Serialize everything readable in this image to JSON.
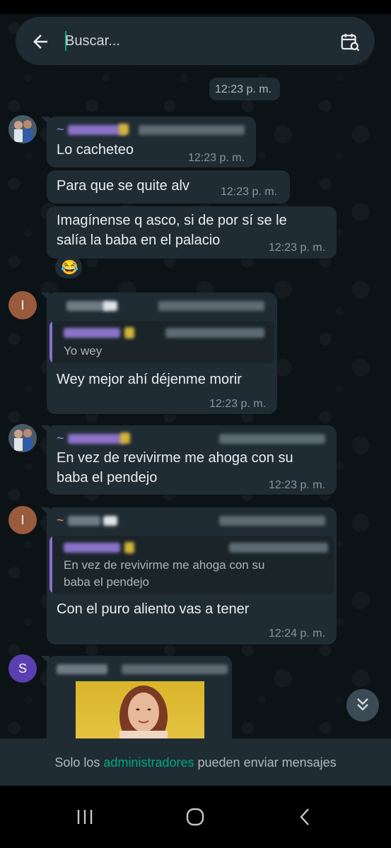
{
  "search": {
    "placeholder": "Buscar..."
  },
  "date_pill": "12:23 p. m.",
  "messages": [
    {
      "text": "Lo cacheteo",
      "time": "12:23 p. m."
    },
    {
      "text": "Para que se quite alv",
      "time": "12:23 p. m."
    },
    {
      "line1": "Imagínense q asco, si de por sí se le",
      "line2": "salía la baba en el palacio",
      "time": "12:23 p. m."
    },
    {
      "quote": "Yo wey",
      "text": "Wey mejor ahí déjenme morir",
      "time": "12:23 p. m."
    },
    {
      "line1": "En vez de revivirme me ahoga con su",
      "line2": "baba el pendejo",
      "time": "12:23 p. m."
    },
    {
      "quote_line1": "En vez de revivirme me ahoga con su",
      "quote_line2": "baba el pendejo",
      "text": "Con el puro aliento vas a tener",
      "time": "12:24 p. m."
    }
  ],
  "avatars": {
    "i_letter": "I",
    "s_letter": "S"
  },
  "sender_prefix": "~",
  "reaction_emoji": "😂",
  "footer": {
    "prefix": "Solo los",
    "highlight": "administradores",
    "suffix": "pueden enviar mensajes"
  },
  "colors": {
    "accent": "#00a884",
    "bubble": "#202c33",
    "background": "#0b141a",
    "avatar_i": "#9a5a3c",
    "avatar_s": "#5b3fb0"
  }
}
